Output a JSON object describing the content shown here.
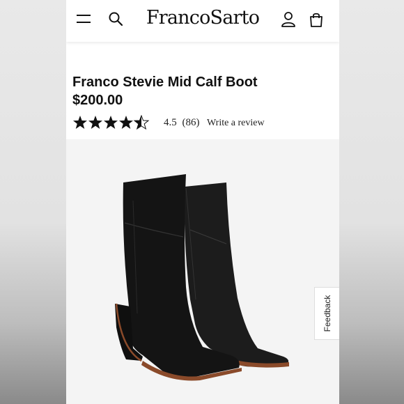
{
  "header": {
    "logo": "FrancoSarto",
    "icons": [
      "menu-icon",
      "search-icon",
      "account-icon",
      "bag-icon"
    ]
  },
  "product": {
    "title": "Franco Stevie Mid Calf Boot",
    "price": "$200.00",
    "rating_value": 4.5,
    "rating_text": "4.5",
    "review_count": "(86)",
    "review_link": "Write a review",
    "star_icon": "star-icon"
  },
  "feedback": {
    "label": "Feedback"
  },
  "colors": {
    "text": "#111111",
    "image_bg": "#f4f4f4",
    "boot": "#1a1a1a",
    "welt": "#8a4a2a"
  }
}
